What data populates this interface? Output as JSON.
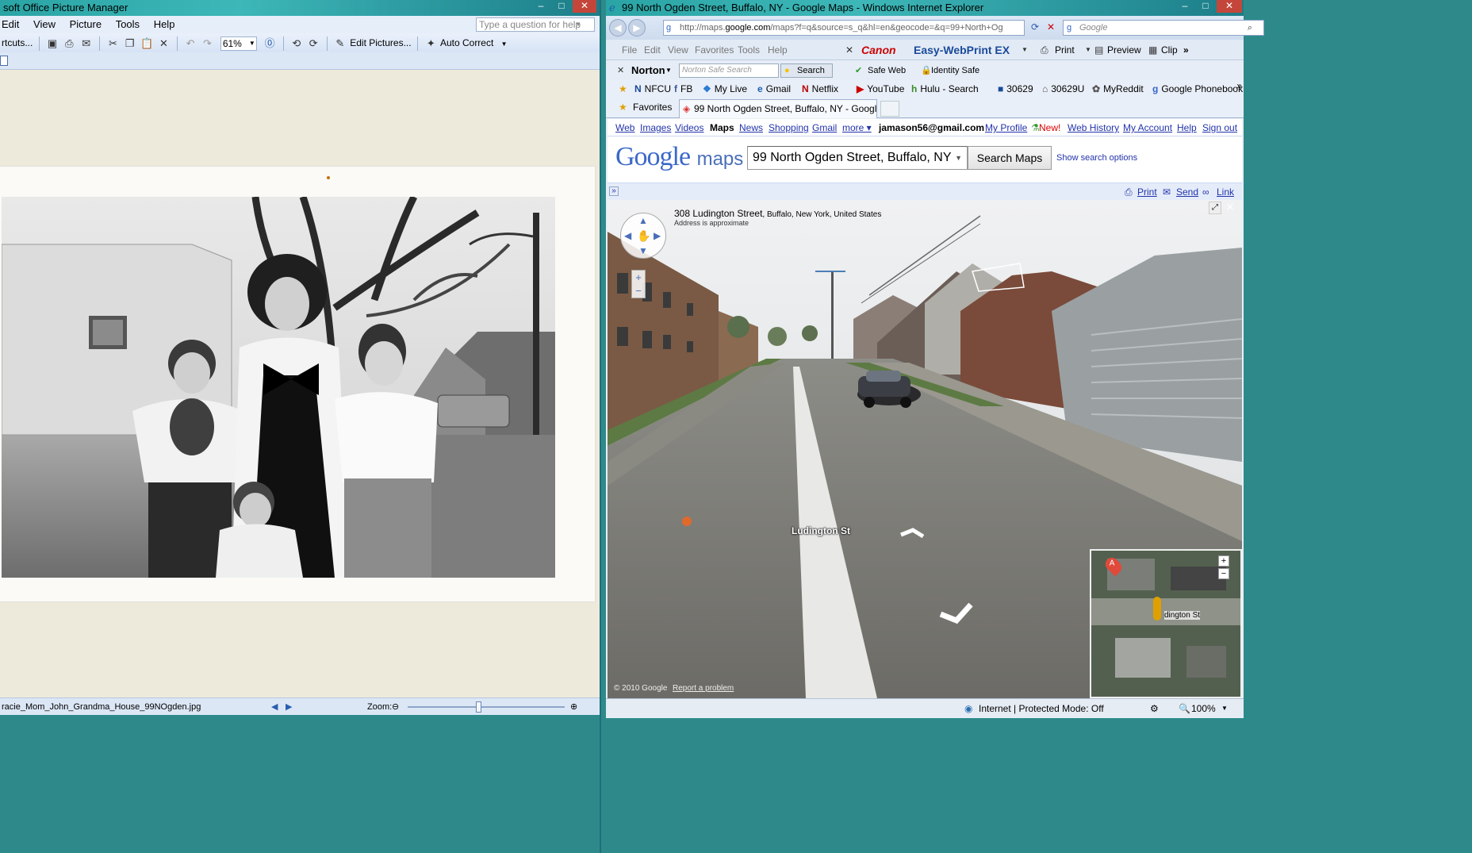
{
  "pm": {
    "title": "soft Office Picture Manager",
    "menu": [
      "Edit",
      "View",
      "Picture",
      "Tools",
      "Help"
    ],
    "help_placeholder": "Type a question for help",
    "shortcuts": "rtcuts...",
    "zoom_combo": "61%",
    "edit_pictures": "Edit Pictures...",
    "auto_correct": "Auto Correct",
    "filename": "racie_Mom_John_Grandma_House_99NOgden.jpg",
    "zoom_label": "Zoom:",
    "zoom_level": 0.45
  },
  "ie": {
    "title": "99 North Ogden Street, Buffalo, NY - Google Maps - Windows Internet Explorer",
    "url_prefix": "http://maps.",
    "url_domain": "google.com",
    "url_rest": "/maps?f=q&source=s_q&hl=en&geocode=&q=99+North+Og",
    "search_placeholder": "Google",
    "menu": [
      "File",
      "Edit",
      "View",
      "Favorites",
      "Tools",
      "Help"
    ],
    "canon": "Canon",
    "webprint": "Easy-WebPrint EX",
    "print": "Print",
    "preview": "Preview",
    "clip": "Clip",
    "norton": "Norton",
    "norton_placeholder": "Norton Safe Search",
    "norton_search": "Search",
    "safe_web": "Safe Web",
    "identity_safe": "Identity Safe",
    "favorites_bar": [
      {
        "label": "NFCU",
        "icon": "nfcu-icon"
      },
      {
        "label": "FB",
        "icon": "facebook-icon"
      },
      {
        "label": "My Live",
        "icon": "windows-live-icon"
      },
      {
        "label": "Gmail",
        "icon": "gmail-icon"
      },
      {
        "label": "Netflix",
        "icon": "netflix-icon"
      },
      {
        "label": "YouTube",
        "icon": "youtube-icon"
      },
      {
        "label": "Hulu - Search",
        "icon": "hulu-icon"
      },
      {
        "label": "30629",
        "icon": "twc-icon"
      },
      {
        "label": "30629U",
        "icon": "shoe-icon"
      },
      {
        "label": "MyReddit",
        "icon": "reddit-icon"
      },
      {
        "label": "Google Phonebook",
        "icon": "google-icon"
      }
    ],
    "favorites": "Favorites",
    "tab_title": "99 North Ogden Street, Buffalo, NY - Google Maps",
    "status": "Internet | Protected Mode: Off",
    "zoom": "100%"
  },
  "gmaps": {
    "nav": [
      "Web",
      "Images",
      "Videos",
      "Maps",
      "News",
      "Shopping",
      "Gmail",
      "more ▾"
    ],
    "user": "jamason56@gmail.com",
    "account_links": [
      "My Profile",
      "New!",
      "Web History",
      "My Account",
      "Help",
      "Sign out"
    ],
    "logo_google": "Google",
    "logo_maps": "maps",
    "query": "99 North Ogden Street, Buffalo, NY",
    "search_button": "Search Maps",
    "show_options": "Show search options",
    "print": "Print",
    "send": "Send",
    "link": "Link",
    "address_bold": "308 Ludington Street",
    "address_rest": ", Buffalo, New York, United States",
    "approx": "Address is approximate",
    "street_label": "Ludington St",
    "minimap_label": "dington St",
    "marker": "A",
    "copyright": "© 2010 Google",
    "report": "Report a problem"
  },
  "colors": {
    "accent_blue": "#2233aa",
    "norton_yellow": "#f5c400",
    "canon_red": "#cc0000",
    "new_red": "#dd0000"
  }
}
